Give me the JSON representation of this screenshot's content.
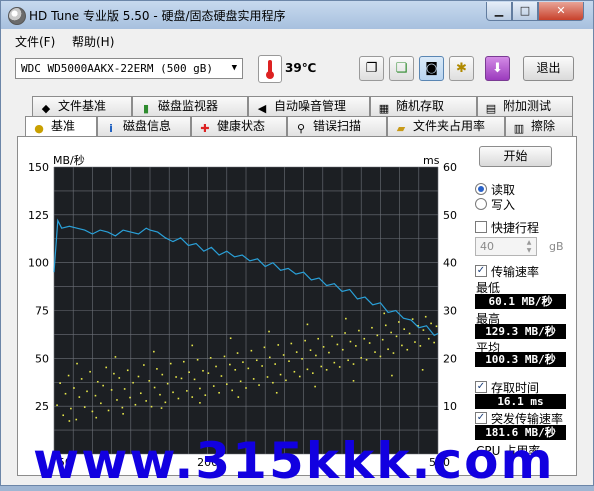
{
  "window": {
    "title": "HD Tune 专业版 5.50 - 硬盘/固态硬盘实用程序"
  },
  "menu": [
    {
      "label": "文件(F)"
    },
    {
      "label": "帮助(H)"
    }
  ],
  "toolbar": {
    "device": "WDC WD5000AAKX-22ERM (500 gB)",
    "temperature": "39℃",
    "icons": [
      "copy-text-icon",
      "copy-screenshot-icon",
      "camera-icon",
      "options-icon",
      "save-icon"
    ],
    "exit_label": "退出"
  },
  "tabs_row1": [
    {
      "label": "文件基准",
      "icon": "file-benchmark-icon"
    },
    {
      "label": "磁盘监视器",
      "icon": "disk-monitor-icon"
    },
    {
      "label": "自动噪音管理",
      "icon": "speaker-icon"
    },
    {
      "label": "随机存取",
      "icon": "random-access-icon"
    },
    {
      "label": "附加测试",
      "icon": "extra-tests-icon"
    }
  ],
  "tabs_row2": [
    {
      "label": "基准",
      "icon": "lightbulb-icon",
      "selected": true
    },
    {
      "label": "磁盘信息",
      "icon": "info-icon"
    },
    {
      "label": "健康状态",
      "icon": "health-cross-icon"
    },
    {
      "label": "错误扫描",
      "icon": "magnifier-icon"
    },
    {
      "label": "文件夹占用率",
      "icon": "folder-icon"
    },
    {
      "label": "擦除",
      "icon": "trash-icon"
    }
  ],
  "side_panel": {
    "start_label": "开始",
    "read_label": "读取",
    "write_label": "写入",
    "quick_label": "快捷行程",
    "quick_value": "40",
    "quick_unit": "gB",
    "transfer_label": "传输速率",
    "min_label": "最低",
    "min_value": "60.1 MB/秒",
    "max_label": "最高",
    "max_value": "129.3 MB/秒",
    "avg_label": "平均",
    "avg_value": "100.3 MB/秒",
    "access_label": "存取时间",
    "access_value": "16.1 ms",
    "burst_label": "突发传输速率",
    "burst_value": "181.6 MB/秒",
    "cpu_label": "CPU 占用率"
  },
  "watermark": "www.315kkk.com",
  "chart_data": {
    "type": "line",
    "y_left_label": "MB/秒",
    "y_right_label": "ms",
    "y_left_ticks": [
      25,
      50,
      75,
      100,
      125,
      150
    ],
    "y_right_ticks": [
      10,
      20,
      30,
      40,
      50,
      60
    ],
    "x_tick_labels": [
      "50",
      "200",
      "500"
    ],
    "x_axis_unit": "gB",
    "xlim": [
      0,
      500
    ],
    "ylim_left": [
      0,
      150
    ],
    "ylim_right": [
      0,
      60
    ],
    "grid": true,
    "colors": {
      "background": "#1c1f23",
      "grid": "#6d7178",
      "transfer_line": "#2aa0d8",
      "access_points": "#e8e84a"
    },
    "series": [
      {
        "name": "传输速率",
        "unit": "MB/秒",
        "x": [
          0,
          5,
          10,
          20,
          30,
          40,
          50,
          60,
          70,
          80,
          90,
          100,
          110,
          120,
          125,
          135,
          145,
          155,
          165,
          175,
          185,
          195,
          205,
          215,
          225,
          235,
          245,
          255,
          265,
          275,
          285,
          295,
          305,
          315,
          325,
          335,
          345,
          355,
          365,
          375,
          385,
          395,
          405,
          415,
          425,
          435,
          445,
          455,
          465,
          475,
          485,
          495,
          500
        ],
        "y": [
          95,
          122,
          118,
          119,
          118,
          117,
          115,
          117,
          116,
          114,
          117,
          116,
          115,
          118,
          117,
          116,
          113,
          111,
          113,
          109,
          110,
          106,
          108,
          104,
          106,
          103,
          104,
          101,
          102,
          98,
          100,
          96,
          97,
          94,
          95,
          91,
          92,
          88,
          89,
          85,
          86,
          81,
          82,
          78,
          79,
          74,
          75,
          71,
          70,
          66,
          67,
          62,
          63
        ]
      },
      {
        "name": "存取时间",
        "unit": "ms",
        "points": [
          [
            4,
            10.2
          ],
          [
            8,
            14.8
          ],
          [
            12,
            8.1
          ],
          [
            15,
            12.6
          ],
          [
            19,
            16.4
          ],
          [
            22,
            9.5
          ],
          [
            26,
            13.8
          ],
          [
            29,
            7.2
          ],
          [
            33,
            11.9
          ],
          [
            36,
            15.7
          ],
          [
            40,
            9.8
          ],
          [
            43,
            13.1
          ],
          [
            47,
            17.2
          ],
          [
            50,
            8.9
          ],
          [
            54,
            12.2
          ],
          [
            57,
            15.1
          ],
          [
            61,
            10.6
          ],
          [
            64,
            14.3
          ],
          [
            68,
            18.1
          ],
          [
            71,
            9.1
          ],
          [
            75,
            13.4
          ],
          [
            78,
            16.8
          ],
          [
            82,
            11.3
          ],
          [
            85,
            15.9
          ],
          [
            89,
            9.7
          ],
          [
            92,
            13.6
          ],
          [
            96,
            17.5
          ],
          [
            99,
            11.8
          ],
          [
            103,
            14.9
          ],
          [
            106,
            10.3
          ],
          [
            110,
            16.2
          ],
          [
            113,
            12.7
          ],
          [
            117,
            18.6
          ],
          [
            120,
            11.1
          ],
          [
            124,
            15.3
          ],
          [
            127,
            9.9
          ],
          [
            131,
            13.9
          ],
          [
            134,
            17.8
          ],
          [
            138,
            12.4
          ],
          [
            141,
            16.6
          ],
          [
            145,
            10.8
          ],
          [
            148,
            14.7
          ],
          [
            152,
            18.9
          ],
          [
            155,
            12.9
          ],
          [
            159,
            16.1
          ],
          [
            162,
            11.6
          ],
          [
            166,
            15.8
          ],
          [
            169,
            19.3
          ],
          [
            173,
            13.2
          ],
          [
            176,
            17.1
          ],
          [
            180,
            11.9
          ],
          [
            183,
            15.6
          ],
          [
            187,
            19.7
          ],
          [
            190,
            13.7
          ],
          [
            194,
            17.4
          ],
          [
            197,
            12.3
          ],
          [
            201,
            16.9
          ],
          [
            204,
            20.1
          ],
          [
            208,
            14.2
          ],
          [
            211,
            18.3
          ],
          [
            215,
            12.8
          ],
          [
            218,
            16.3
          ],
          [
            222,
            20.4
          ],
          [
            225,
            14.6
          ],
          [
            229,
            18.7
          ],
          [
            232,
            13.3
          ],
          [
            236,
            17.6
          ],
          [
            239,
            21.1
          ],
          [
            243,
            15.2
          ],
          [
            246,
            19.2
          ],
          [
            250,
            13.8
          ],
          [
            253,
            17.9
          ],
          [
            257,
            21.6
          ],
          [
            260,
            15.7
          ],
          [
            264,
            19.6
          ],
          [
            267,
            14.4
          ],
          [
            271,
            18.4
          ],
          [
            274,
            22.3
          ],
          [
            278,
            16.1
          ],
          [
            281,
            20.2
          ],
          [
            285,
            14.9
          ],
          [
            288,
            18.8
          ],
          [
            292,
            22.8
          ],
          [
            295,
            16.6
          ],
          [
            299,
            20.7
          ],
          [
            302,
            15.4
          ],
          [
            306,
            19.4
          ],
          [
            309,
            23.1
          ],
          [
            313,
            17.2
          ],
          [
            316,
            21.3
          ],
          [
            320,
            16.2
          ],
          [
            323,
            19.9
          ],
          [
            327,
            23.7
          ],
          [
            330,
            17.7
          ],
          [
            334,
            21.7
          ],
          [
            337,
            16.9
          ],
          [
            341,
            20.6
          ],
          [
            344,
            24.1
          ],
          [
            348,
            18.3
          ],
          [
            351,
            22.4
          ],
          [
            355,
            17.6
          ],
          [
            358,
            21.2
          ],
          [
            362,
            24.6
          ],
          [
            365,
            19.1
          ],
          [
            369,
            22.9
          ],
          [
            372,
            18.2
          ],
          [
            376,
            21.8
          ],
          [
            379,
            25.3
          ],
          [
            383,
            19.6
          ],
          [
            386,
            23.5
          ],
          [
            390,
            18.8
          ],
          [
            393,
            22.6
          ],
          [
            397,
            25.8
          ],
          [
            400,
            20.1
          ],
          [
            404,
            24.1
          ],
          [
            407,
            19.7
          ],
          [
            411,
            23.2
          ],
          [
            414,
            26.4
          ],
          [
            418,
            21.3
          ],
          [
            421,
            24.8
          ],
          [
            425,
            20.4
          ],
          [
            428,
            23.9
          ],
          [
            432,
            26.9
          ],
          [
            435,
            21.9
          ],
          [
            439,
            25.4
          ],
          [
            442,
            21.1
          ],
          [
            446,
            24.6
          ],
          [
            449,
            27.6
          ],
          [
            453,
            22.7
          ],
          [
            456,
            26.1
          ],
          [
            460,
            21.8
          ],
          [
            463,
            25.2
          ],
          [
            467,
            28.2
          ],
          [
            470,
            23.4
          ],
          [
            474,
            26.8
          ],
          [
            477,
            22.6
          ],
          [
            481,
            25.9
          ],
          [
            484,
            28.7
          ],
          [
            488,
            24.1
          ],
          [
            491,
            27.3
          ],
          [
            495,
            23.3
          ],
          [
            498,
            26.7
          ],
          [
            20,
            6.9
          ],
          [
            55,
            7.6
          ],
          [
            90,
            8.4
          ],
          [
            140,
            9.6
          ],
          [
            190,
            10.7
          ],
          [
            240,
            11.9
          ],
          [
            290,
            12.8
          ],
          [
            340,
            14.1
          ],
          [
            390,
            15.3
          ],
          [
            440,
            16.4
          ],
          [
            480,
            17.6
          ],
          [
            30,
            18.9
          ],
          [
            80,
            20.3
          ],
          [
            130,
            21.4
          ],
          [
            180,
            22.7
          ],
          [
            230,
            24.2
          ],
          [
            280,
            25.6
          ],
          [
            330,
            27.1
          ],
          [
            380,
            28.3
          ],
          [
            430,
            29.4
          ]
        ]
      }
    ]
  }
}
